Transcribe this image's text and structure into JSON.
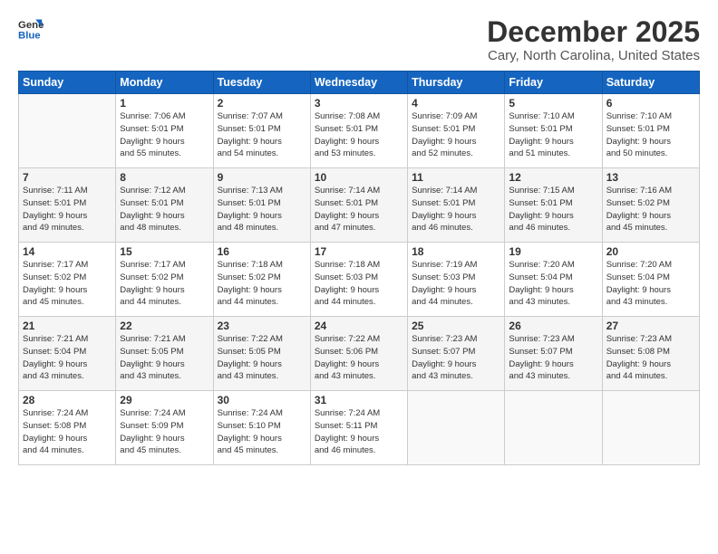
{
  "logo": {
    "line1": "General",
    "line2": "Blue"
  },
  "title": "December 2025",
  "location": "Cary, North Carolina, United States",
  "days_of_week": [
    "Sunday",
    "Monday",
    "Tuesday",
    "Wednesday",
    "Thursday",
    "Friday",
    "Saturday"
  ],
  "weeks": [
    [
      {
        "day": "",
        "info": ""
      },
      {
        "day": "1",
        "info": "Sunrise: 7:06 AM\nSunset: 5:01 PM\nDaylight: 9 hours\nand 55 minutes."
      },
      {
        "day": "2",
        "info": "Sunrise: 7:07 AM\nSunset: 5:01 PM\nDaylight: 9 hours\nand 54 minutes."
      },
      {
        "day": "3",
        "info": "Sunrise: 7:08 AM\nSunset: 5:01 PM\nDaylight: 9 hours\nand 53 minutes."
      },
      {
        "day": "4",
        "info": "Sunrise: 7:09 AM\nSunset: 5:01 PM\nDaylight: 9 hours\nand 52 minutes."
      },
      {
        "day": "5",
        "info": "Sunrise: 7:10 AM\nSunset: 5:01 PM\nDaylight: 9 hours\nand 51 minutes."
      },
      {
        "day": "6",
        "info": "Sunrise: 7:10 AM\nSunset: 5:01 PM\nDaylight: 9 hours\nand 50 minutes."
      }
    ],
    [
      {
        "day": "7",
        "info": "Sunrise: 7:11 AM\nSunset: 5:01 PM\nDaylight: 9 hours\nand 49 minutes."
      },
      {
        "day": "8",
        "info": "Sunrise: 7:12 AM\nSunset: 5:01 PM\nDaylight: 9 hours\nand 48 minutes."
      },
      {
        "day": "9",
        "info": "Sunrise: 7:13 AM\nSunset: 5:01 PM\nDaylight: 9 hours\nand 48 minutes."
      },
      {
        "day": "10",
        "info": "Sunrise: 7:14 AM\nSunset: 5:01 PM\nDaylight: 9 hours\nand 47 minutes."
      },
      {
        "day": "11",
        "info": "Sunrise: 7:14 AM\nSunset: 5:01 PM\nDaylight: 9 hours\nand 46 minutes."
      },
      {
        "day": "12",
        "info": "Sunrise: 7:15 AM\nSunset: 5:01 PM\nDaylight: 9 hours\nand 46 minutes."
      },
      {
        "day": "13",
        "info": "Sunrise: 7:16 AM\nSunset: 5:02 PM\nDaylight: 9 hours\nand 45 minutes."
      }
    ],
    [
      {
        "day": "14",
        "info": "Sunrise: 7:17 AM\nSunset: 5:02 PM\nDaylight: 9 hours\nand 45 minutes."
      },
      {
        "day": "15",
        "info": "Sunrise: 7:17 AM\nSunset: 5:02 PM\nDaylight: 9 hours\nand 44 minutes."
      },
      {
        "day": "16",
        "info": "Sunrise: 7:18 AM\nSunset: 5:02 PM\nDaylight: 9 hours\nand 44 minutes."
      },
      {
        "day": "17",
        "info": "Sunrise: 7:18 AM\nSunset: 5:03 PM\nDaylight: 9 hours\nand 44 minutes."
      },
      {
        "day": "18",
        "info": "Sunrise: 7:19 AM\nSunset: 5:03 PM\nDaylight: 9 hours\nand 44 minutes."
      },
      {
        "day": "19",
        "info": "Sunrise: 7:20 AM\nSunset: 5:04 PM\nDaylight: 9 hours\nand 43 minutes."
      },
      {
        "day": "20",
        "info": "Sunrise: 7:20 AM\nSunset: 5:04 PM\nDaylight: 9 hours\nand 43 minutes."
      }
    ],
    [
      {
        "day": "21",
        "info": "Sunrise: 7:21 AM\nSunset: 5:04 PM\nDaylight: 9 hours\nand 43 minutes."
      },
      {
        "day": "22",
        "info": "Sunrise: 7:21 AM\nSunset: 5:05 PM\nDaylight: 9 hours\nand 43 minutes."
      },
      {
        "day": "23",
        "info": "Sunrise: 7:22 AM\nSunset: 5:05 PM\nDaylight: 9 hours\nand 43 minutes."
      },
      {
        "day": "24",
        "info": "Sunrise: 7:22 AM\nSunset: 5:06 PM\nDaylight: 9 hours\nand 43 minutes."
      },
      {
        "day": "25",
        "info": "Sunrise: 7:23 AM\nSunset: 5:07 PM\nDaylight: 9 hours\nand 43 minutes."
      },
      {
        "day": "26",
        "info": "Sunrise: 7:23 AM\nSunset: 5:07 PM\nDaylight: 9 hours\nand 43 minutes."
      },
      {
        "day": "27",
        "info": "Sunrise: 7:23 AM\nSunset: 5:08 PM\nDaylight: 9 hours\nand 44 minutes."
      }
    ],
    [
      {
        "day": "28",
        "info": "Sunrise: 7:24 AM\nSunset: 5:08 PM\nDaylight: 9 hours\nand 44 minutes."
      },
      {
        "day": "29",
        "info": "Sunrise: 7:24 AM\nSunset: 5:09 PM\nDaylight: 9 hours\nand 45 minutes."
      },
      {
        "day": "30",
        "info": "Sunrise: 7:24 AM\nSunset: 5:10 PM\nDaylight: 9 hours\nand 45 minutes."
      },
      {
        "day": "31",
        "info": "Sunrise: 7:24 AM\nSunset: 5:11 PM\nDaylight: 9 hours\nand 46 minutes."
      },
      {
        "day": "",
        "info": ""
      },
      {
        "day": "",
        "info": ""
      },
      {
        "day": "",
        "info": ""
      }
    ]
  ]
}
